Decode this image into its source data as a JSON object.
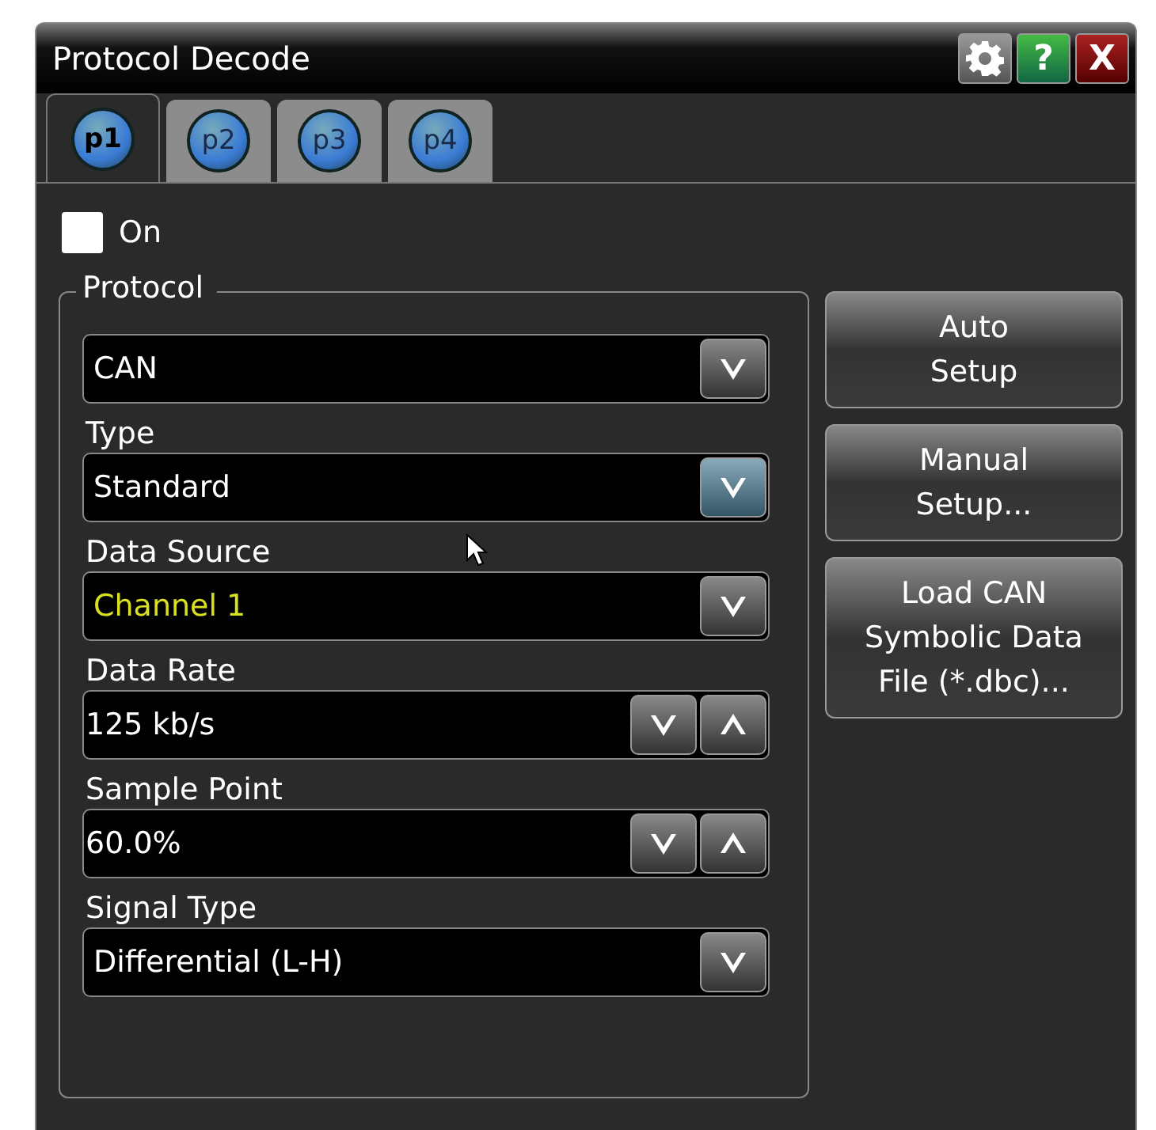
{
  "window": {
    "title": "Protocol Decode"
  },
  "title_buttons": [
    {
      "kind": "settings"
    },
    {
      "kind": "help",
      "label": "?"
    },
    {
      "kind": "close",
      "label": "X"
    }
  ],
  "tabs": [
    {
      "label": "p1",
      "selected": true
    },
    {
      "label": "p2",
      "selected": false
    },
    {
      "label": "p3",
      "selected": false
    },
    {
      "label": "p4",
      "selected": false
    }
  ],
  "on_checkbox": {
    "label": "On",
    "checked": false
  },
  "protocol_group": {
    "title": "Protocol",
    "fields": [
      {
        "kind": "dropdown",
        "value": "CAN",
        "highlighted": false
      },
      {
        "kind": "dropdown",
        "label": "Type",
        "value": "Standard",
        "highlighted": true
      },
      {
        "kind": "dropdown",
        "label": "Data Source",
        "value": "Channel 1",
        "color": "#d8e020",
        "highlighted": false
      },
      {
        "kind": "stepper",
        "label": "Data Rate",
        "value": "125 kb/s"
      },
      {
        "kind": "stepper",
        "label": "Sample Point",
        "value": "60.0%"
      },
      {
        "kind": "dropdown",
        "label": "Signal Type",
        "value": "Differential (L-H)",
        "highlighted": false
      }
    ]
  },
  "side_buttons": [
    [
      "Auto",
      "Setup"
    ],
    [
      "Manual",
      "Setup..."
    ],
    [
      "Load CAN",
      "Symbolic Data",
      "File (*.dbc)..."
    ]
  ]
}
